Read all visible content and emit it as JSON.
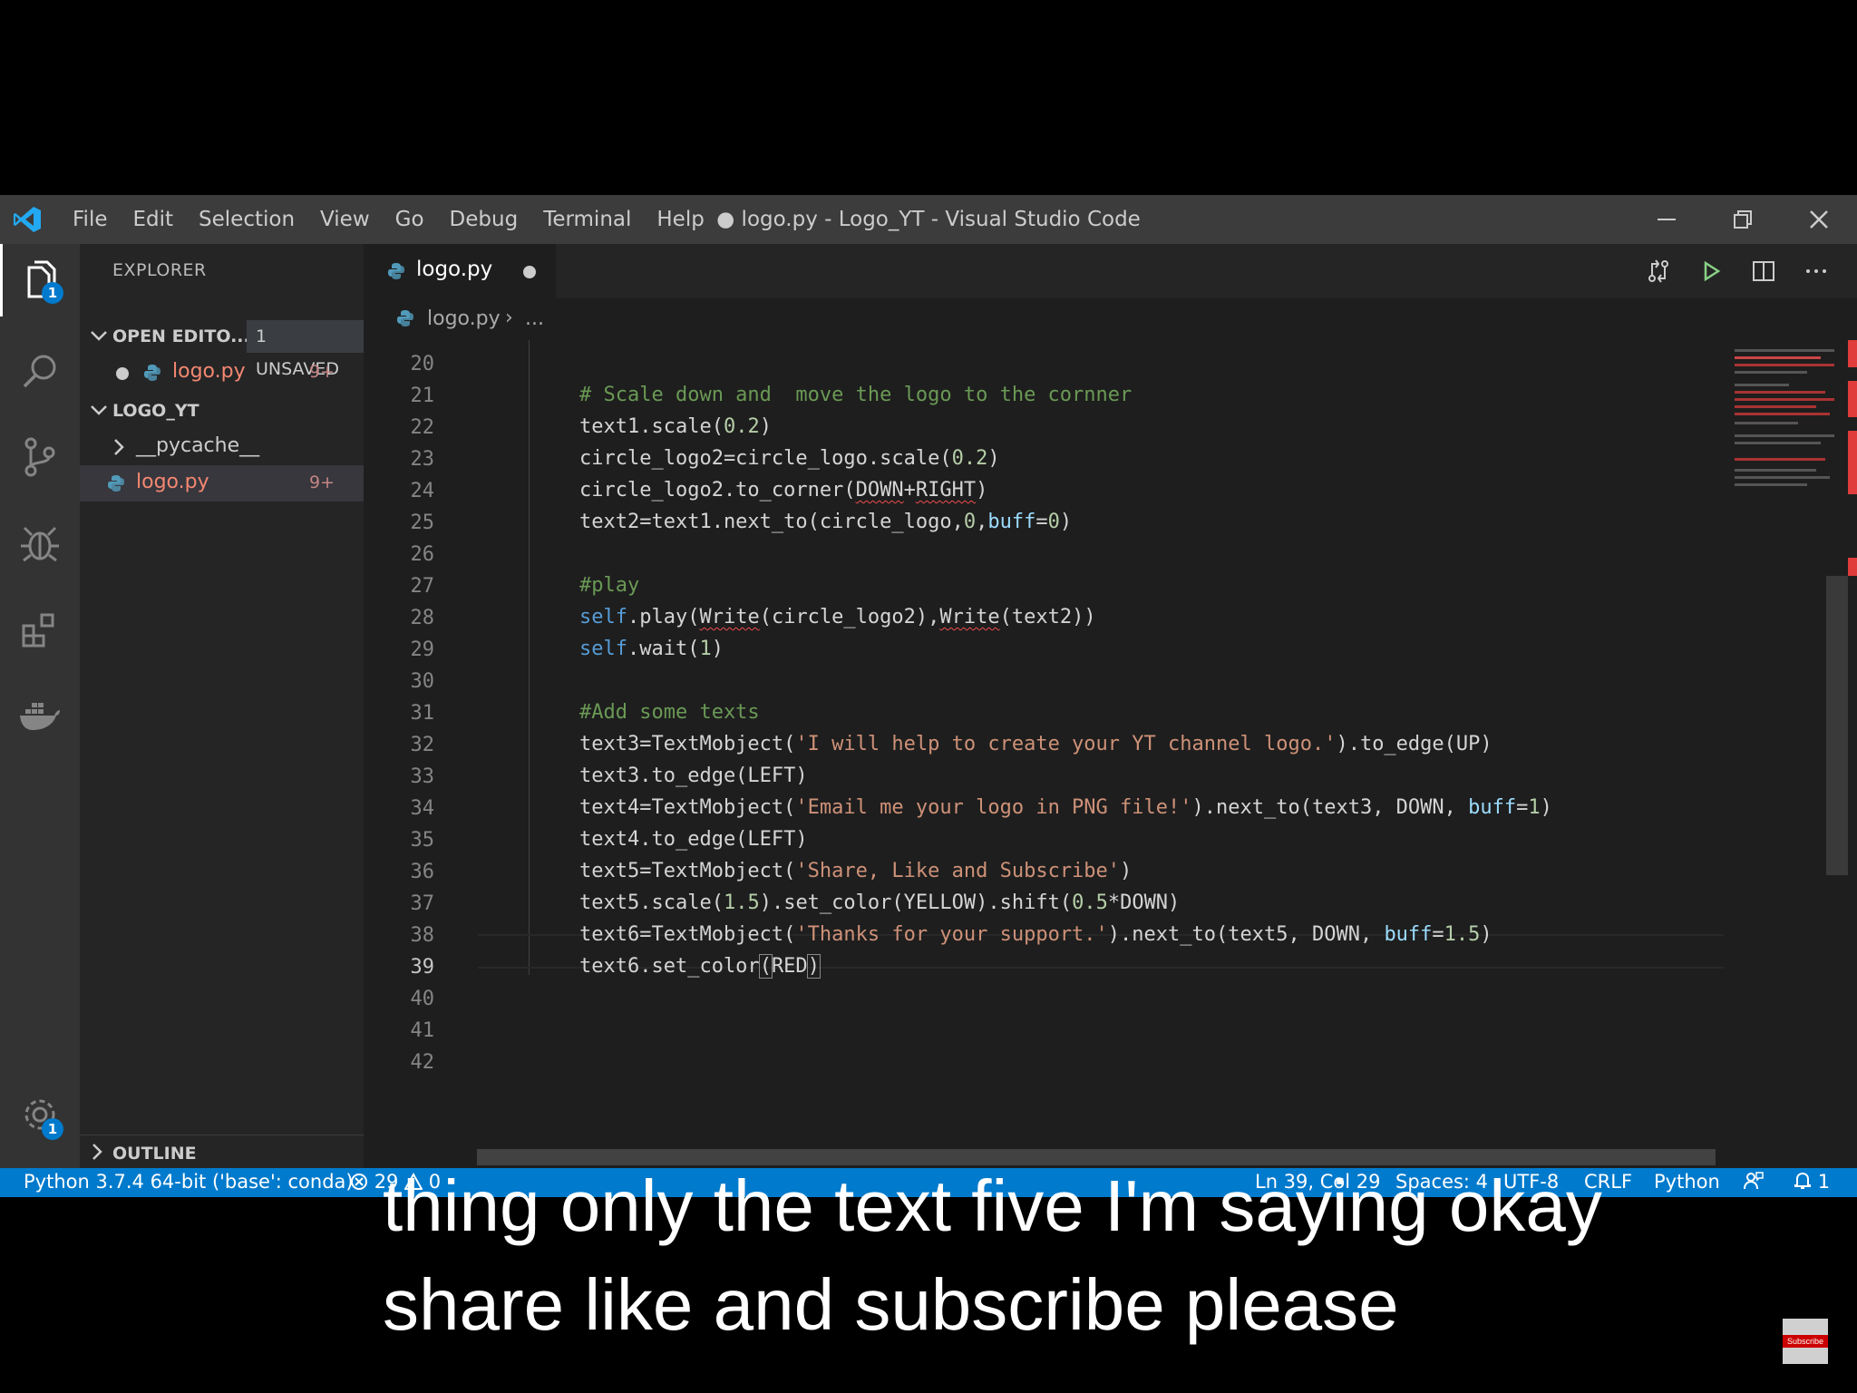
{
  "window": {
    "title": "● logo.py - Logo_YT - Visual Studio Code",
    "menu": [
      "File",
      "Edit",
      "Selection",
      "View",
      "Go",
      "Debug",
      "Terminal",
      "Help"
    ]
  },
  "activity_bar": {
    "explorer_badge": "1",
    "settings_badge": "1"
  },
  "sidebar": {
    "title": "EXPLORER",
    "open_editors": {
      "label": "OPEN EDITO...",
      "unsaved": "1 UNSAVED",
      "file": "logo.py",
      "count": "9+"
    },
    "folder": {
      "label": "LOGO_YT",
      "items": [
        {
          "name": "__pycache__",
          "count": ""
        },
        {
          "name": "logo.py",
          "count": "9+"
        }
      ]
    },
    "outline": "OUTLINE"
  },
  "editor": {
    "tab": "logo.py",
    "breadcrumb_file": "logo.py",
    "breadcrumb_sep": "›",
    "breadcrumb_more": "...",
    "line_numbers": [
      "20",
      "21",
      "22",
      "23",
      "24",
      "25",
      "26",
      "27",
      "28",
      "29",
      "30",
      "31",
      "32",
      "33",
      "34",
      "35",
      "36",
      "37",
      "38",
      "39",
      "40",
      "41",
      "42"
    ]
  },
  "status_bar": {
    "interpreter": "Python 3.7.4 64-bit ('base': conda)",
    "errors": "29",
    "warnings": "0",
    "position": "Ln 39, Col 29",
    "spaces": "Spaces: 4",
    "encoding": "UTF-8",
    "eol": "CRLF",
    "language": "Python",
    "notifications": "1"
  },
  "captions": [
    "thing only the text five I'm saying okay",
    "share like and subscribe please"
  ],
  "subscribe_label": "Subscribe",
  "colors": {
    "titlebar": "#3c3c3c",
    "activity_bar": "#333333",
    "sidebar": "#252526",
    "editor": "#1e1e1e",
    "status_bar": "#007acc",
    "error_file": "#f48771",
    "comment": "#6a9955",
    "string": "#ce9178",
    "number": "#b5cea8",
    "keyword": "#569cd6"
  }
}
